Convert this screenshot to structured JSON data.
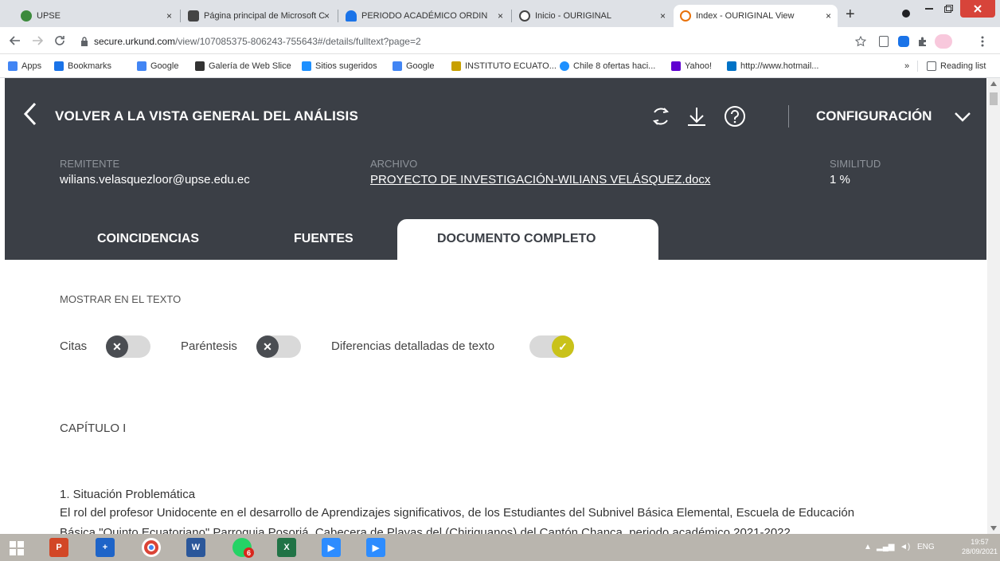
{
  "browser": {
    "tabs": [
      {
        "title": "UPSE",
        "color": "#3c8a3c"
      },
      {
        "title": "Página principal de Microsoft C",
        "color": "#444444"
      },
      {
        "title": "PERIODO ACADÉMICO ORDIN",
        "color": "#1a73e8"
      },
      {
        "title": "Inicio - OURIGINAL",
        "color": "#444444"
      },
      {
        "title": "Index - OURIGINAL View",
        "color": "#e8710a"
      }
    ],
    "close_glyph": "×",
    "new_tab": "+",
    "url_host": "secure.urkund.com",
    "url_path": "/view/107085375-806243-755643#/details/fulltext?page=2",
    "bookmarks": [
      {
        "label": "Apps",
        "color": "#4285f4"
      },
      {
        "label": "Bookmarks",
        "color": "#1a73e8"
      },
      {
        "label": "Google",
        "color": "#4285f4"
      },
      {
        "label": "Galería de Web Slice",
        "color": "#333333"
      },
      {
        "label": "Sitios sugeridos",
        "color": "#1e90ff"
      },
      {
        "label": "Google",
        "color": "#4285f4"
      },
      {
        "label": "INSTITUTO ECUATO...",
        "color": "#c8a000"
      },
      {
        "label": "Chile 8 ofertas haci...",
        "color": "#1e90ff"
      },
      {
        "label": "Yahoo!",
        "color": "#5f01d1"
      },
      {
        "label": "http://www.hotmail...",
        "color": "#0072c6"
      }
    ],
    "more_bookmarks": "»",
    "reading_list": "Reading list"
  },
  "header": {
    "back_label": "VOLVER A LA VISTA GENERAL DEL ANÁLISIS",
    "config_label": "CONFIGURACIÓN"
  },
  "meta": {
    "sender_label": "REMITENTE",
    "sender_value": "wilians.velasquezloor@upse.edu.ec",
    "file_label": "ARCHIVO",
    "file_value": "PROYECTO DE INVESTIGACIÓN-WILIANS VELÁSQUEZ.docx",
    "similarity_label": "SIMILITUD",
    "similarity_value": "1 %"
  },
  "tabs": {
    "coincidencias": "COINCIDENCIAS",
    "fuentes": "FUENTES",
    "documento": "DOCUMENTO COMPLETO"
  },
  "content": {
    "show_label": "MOSTRAR EN EL TEXTO",
    "toggles": [
      {
        "label": "Citas",
        "on": false
      },
      {
        "label": "Paréntesis",
        "on": false
      },
      {
        "label": "Diferencias detalladas de texto",
        "on": true
      }
    ],
    "chapter": "CAPÍTULO I",
    "section": "1. Situación Problemática",
    "para_line1": "El rol del profesor Unidocente en el desarrollo de Aprendizajes significativos, de los Estudiantes del Subnivel Básica Elemental, Escuela de Educación",
    "para_line2": "Básica \"Quinto Ecuatoriano\" Parroquia Posorjá, Cabecera de Playas del (Chiriguanos) del Cantón Chanca, periodo académico 2021-2022"
  },
  "taskbar": {
    "badge": "6",
    "lang": "ENG",
    "time": "19:57",
    "date": "28/09/2021"
  },
  "colors": {
    "app_bg": "#3b3f46",
    "toggle_on": "#c9c21a",
    "toggle_off_knob": "#4a4d52"
  }
}
